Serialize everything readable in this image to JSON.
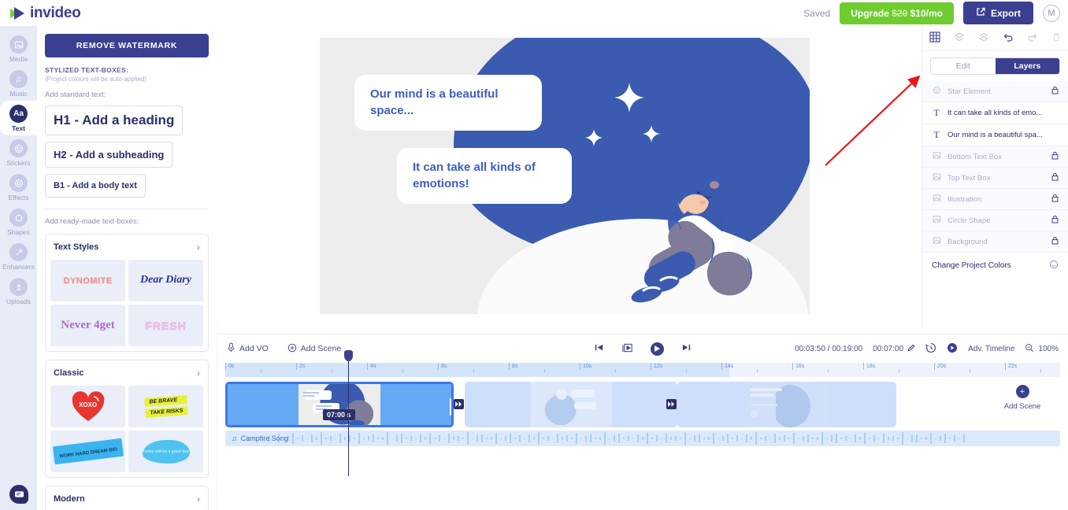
{
  "app": {
    "name": "invideo",
    "logo_icon": "play-triangle-logo"
  },
  "topbar": {
    "saved_label": "Saved",
    "upgrade_old_price": "$20",
    "upgrade_prefix": "Upgrade",
    "upgrade_new_price": "$10/mo",
    "export_label": "Export",
    "export_icon": "external-link-icon",
    "avatar_initial": "M"
  },
  "rail": {
    "items": [
      {
        "label": "Media",
        "icon": "image-icon",
        "active": false
      },
      {
        "label": "Music",
        "icon": "music-note-icon",
        "active": false
      },
      {
        "label": "Text",
        "icon": "Aa",
        "active": true
      },
      {
        "label": "Stickers",
        "icon": "smiley-icon",
        "active": false
      },
      {
        "label": "Effects",
        "icon": "effects-icon",
        "active": false
      },
      {
        "label": "Shapes",
        "icon": "circle-icon",
        "active": false
      },
      {
        "label": "Enhancers",
        "icon": "magic-wand-icon",
        "active": false
      },
      {
        "label": "Uploads",
        "icon": "upload-icon",
        "active": false
      }
    ],
    "chat_icon": "chat-bubble-icon"
  },
  "panel": {
    "remove_watermark": "REMOVE WATERMARK",
    "heading": "STYLIZED TEXT-BOXES:",
    "subheading": "(Project colours will be auto-applied)",
    "add_standard_label": "Add standard text:",
    "buttons": [
      {
        "label": "H1 - Add a heading"
      },
      {
        "label": "H2 - Add a subheading"
      },
      {
        "label": "B1 - Add a body text"
      }
    ],
    "ready_made_label": "Add ready-made text-boxes:",
    "sections": [
      {
        "title": "Text Styles",
        "chevron": "chevron-right-icon",
        "thumbs": [
          {
            "label": "DYNOMITE"
          },
          {
            "label": "Dear Diary"
          },
          {
            "label": "Never 4get"
          },
          {
            "label": "FRESH"
          }
        ]
      },
      {
        "title": "Classic",
        "chevron": "chevron-right-icon",
        "thumbs": [
          {
            "label": "XOXO"
          },
          {
            "label": "BE BRAVE TAKE RISKS"
          },
          {
            "label": "WORK HARD DREAM BIG"
          },
          {
            "label": "Today will be a good day"
          }
        ]
      },
      {
        "title": "Modern",
        "chevron": "chevron-right-icon",
        "thumbs": []
      }
    ]
  },
  "canvas": {
    "bubble_top": "Our mind is a beautiful space...",
    "bubble_bottom": "It can take all kinds of emotions!",
    "bubble_text_color": "#3d5fc4",
    "blob_color": "#3a5bb0"
  },
  "right_panel": {
    "tools": [
      {
        "icon": "grid-icon",
        "active": true
      },
      {
        "icon": "bring-forward-icon",
        "active": false
      },
      {
        "icon": "send-backward-icon",
        "active": false
      },
      {
        "icon": "undo-icon",
        "active": true
      },
      {
        "icon": "redo-icon",
        "active": false
      },
      {
        "icon": "trash-icon",
        "active": false
      }
    ],
    "tabs": [
      {
        "label": "Edit",
        "active": false
      },
      {
        "label": "Layers",
        "active": true
      }
    ],
    "layers": [
      {
        "label": "Star Element",
        "icon": "smiley-icon",
        "locked": true
      },
      {
        "label": "It can take all kinds of emo...",
        "icon": "text-icon",
        "locked": false
      },
      {
        "label": "Our mind is a beautiful spa...",
        "icon": "text-icon",
        "locked": false
      },
      {
        "label": "Bottom Text Box",
        "icon": "image-icon",
        "locked": true
      },
      {
        "label": "Top Text Box",
        "icon": "image-icon",
        "locked": true
      },
      {
        "label": "Illustration",
        "icon": "image-icon",
        "locked": true
      },
      {
        "label": "Circle Shape",
        "icon": "image-icon",
        "locked": true
      },
      {
        "label": "Background",
        "icon": "image-icon",
        "locked": true
      }
    ],
    "change_colors_label": "Change Project Colors",
    "change_colors_icon": "palette-icon",
    "lock_icon": "lock-icon"
  },
  "timeline": {
    "add_vo_label": "Add VO",
    "add_vo_icon": "microphone-icon",
    "add_scene_label": "Add Scene",
    "add_scene_icon": "plus-circle-icon",
    "controls": [
      {
        "icon": "skip-start-icon"
      },
      {
        "icon": "scene-preview-icon"
      },
      {
        "icon": "play-icon"
      },
      {
        "icon": "skip-end-icon"
      }
    ],
    "current_time": "00:03:50",
    "total_time": "00:19:00",
    "scene_duration": "00:07:00",
    "edit_icon": "pencil-icon",
    "history_icon": "clock-history-icon",
    "play_icon": "play-circle-icon",
    "adv_timeline_label": "Adv. Timeline",
    "zoom_icon": "zoom-out-icon",
    "zoom_level": "100%",
    "ruler_ticks": [
      "0s",
      "2s",
      "4s",
      "6s",
      "8s",
      "10s",
      "12s",
      "14s",
      "16s",
      "18s",
      "20s",
      "22s"
    ],
    "clip_tooltip": "07:00 s",
    "transition_icon": "transition-icon",
    "audio_track": {
      "label": "Campfire Song",
      "icon": "music-note-icon"
    },
    "add_scene_tl_label": "Add Scene",
    "add_scene_tl_icon": "plus-icon"
  },
  "annotation": {
    "arrow_color": "#f01414"
  }
}
